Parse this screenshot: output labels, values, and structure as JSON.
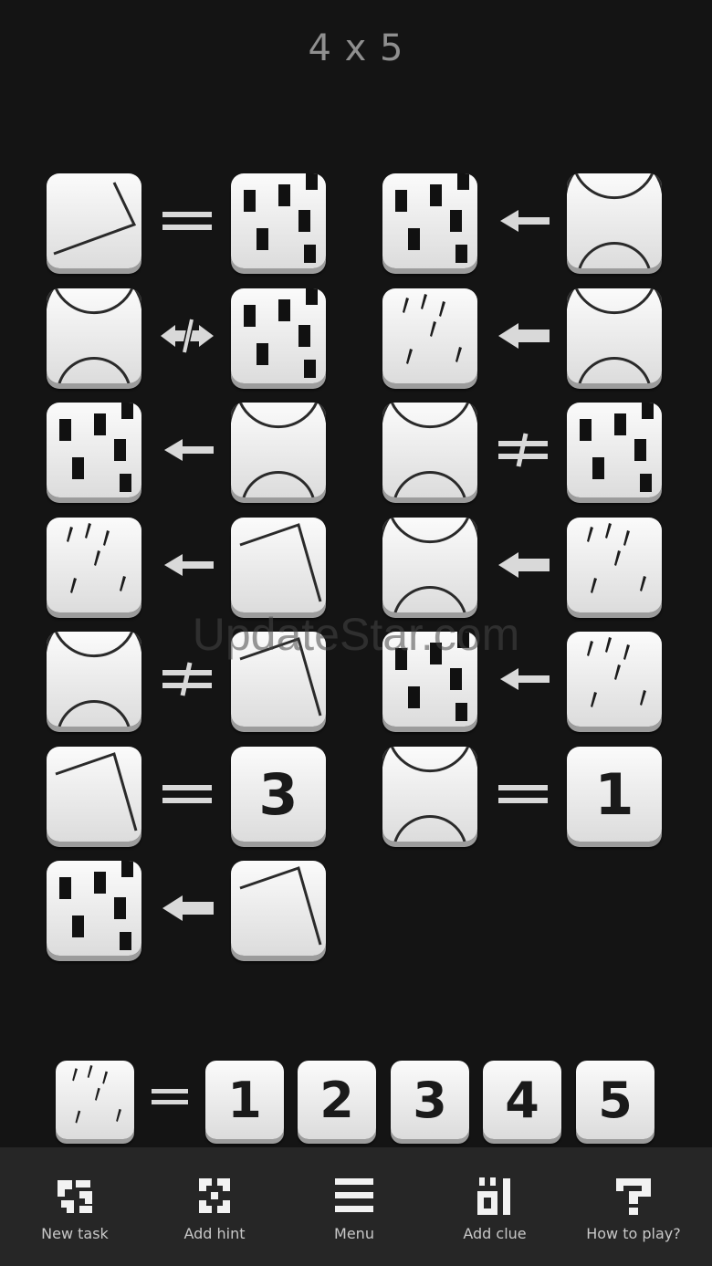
{
  "title": "4 x 5",
  "watermark": "UpdateStar.com",
  "clues": [
    {
      "left": "diagonal-line-icon",
      "relation": "equals",
      "right": "blocks-icon"
    },
    {
      "left": "blocks-icon",
      "relation": "left-arrow",
      "right": "arcs-icon"
    },
    {
      "left": "arcs-icon",
      "relation": "not-adjacent",
      "right": "blocks-icon"
    },
    {
      "left": "rain-icon",
      "relation": "left-arrow-bold",
      "right": "arcs-icon"
    },
    {
      "left": "blocks-icon",
      "relation": "left-arrow",
      "right": "arcs-icon"
    },
    {
      "left": "arcs-icon",
      "relation": "not-equal",
      "right": "blocks-icon"
    },
    {
      "left": "rain-icon",
      "relation": "left-arrow",
      "right": "angle-icon"
    },
    {
      "left": "arcs-icon",
      "relation": "left-arrow-bold",
      "right": "rain-icon"
    },
    {
      "left": "arcs-icon",
      "relation": "not-equal",
      "right": "angle-icon"
    },
    {
      "left": "blocks-icon",
      "relation": "left-arrow",
      "right": "rain-icon"
    },
    {
      "left": "angle-icon",
      "relation": "equals",
      "right_number": "3"
    },
    {
      "left": "arcs-icon",
      "relation": "equals",
      "right_number": "1"
    },
    {
      "left": "blocks-icon",
      "relation": "left-arrow-bold",
      "right": "angle-icon"
    }
  ],
  "answer_row": {
    "symbol": "rain-icon",
    "relation": "equals",
    "options": [
      "1",
      "2",
      "3",
      "4",
      "5"
    ]
  },
  "toolbar": [
    {
      "label": "New task",
      "icon": "new-task-icon"
    },
    {
      "label": "Add hint",
      "icon": "add-hint-icon"
    },
    {
      "label": "Menu",
      "icon": "menu-icon"
    },
    {
      "label": "Add clue",
      "icon": "add-clue-icon"
    },
    {
      "label": "How to play?",
      "icon": "how-to-play-icon"
    }
  ],
  "colors": {
    "background": "#141414",
    "tile": "#f2f2f2",
    "toolbar": "#262626",
    "text": "#c8c8c8"
  }
}
